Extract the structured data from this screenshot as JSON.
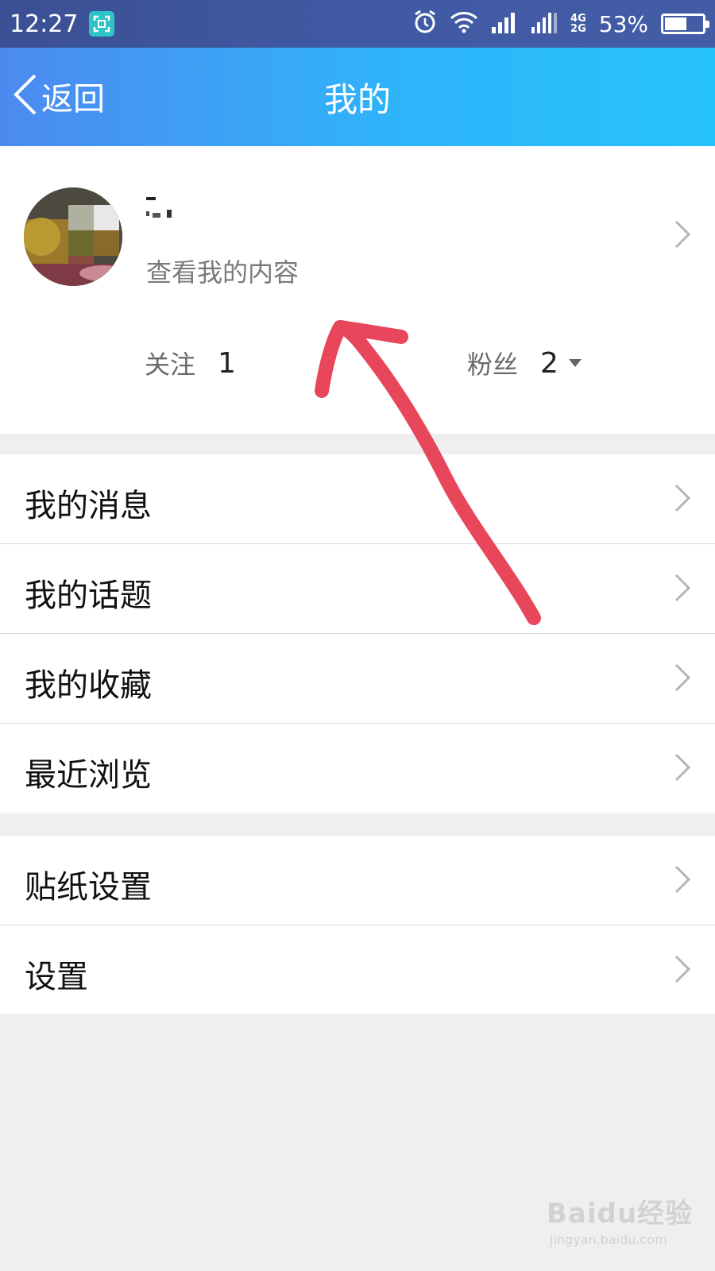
{
  "status_bar": {
    "time": "12:27",
    "network_4g": "4G",
    "network_2g": "2G",
    "battery_percent": "53%",
    "battery_level": 0.53
  },
  "nav": {
    "back_label": "返回",
    "title": "我的"
  },
  "profile": {
    "view_content": "查看我的内容",
    "follow_label": "关注",
    "follow_count": "1",
    "fans_label": "粉丝",
    "fans_count": "2"
  },
  "menu_group_1": [
    {
      "label": "我的消息"
    },
    {
      "label": "我的话题"
    },
    {
      "label": "我的收藏"
    },
    {
      "label": "最近浏览"
    }
  ],
  "menu_group_2": [
    {
      "label": "贴纸设置"
    },
    {
      "label": "设置"
    }
  ],
  "watermark": {
    "main": "Baidu经验",
    "sub": "jingyan.baidu.com"
  },
  "colors": {
    "nav_gradient_start": "#4d8af0",
    "nav_gradient_end": "#27c3fd",
    "annotation": "#e8465a"
  }
}
